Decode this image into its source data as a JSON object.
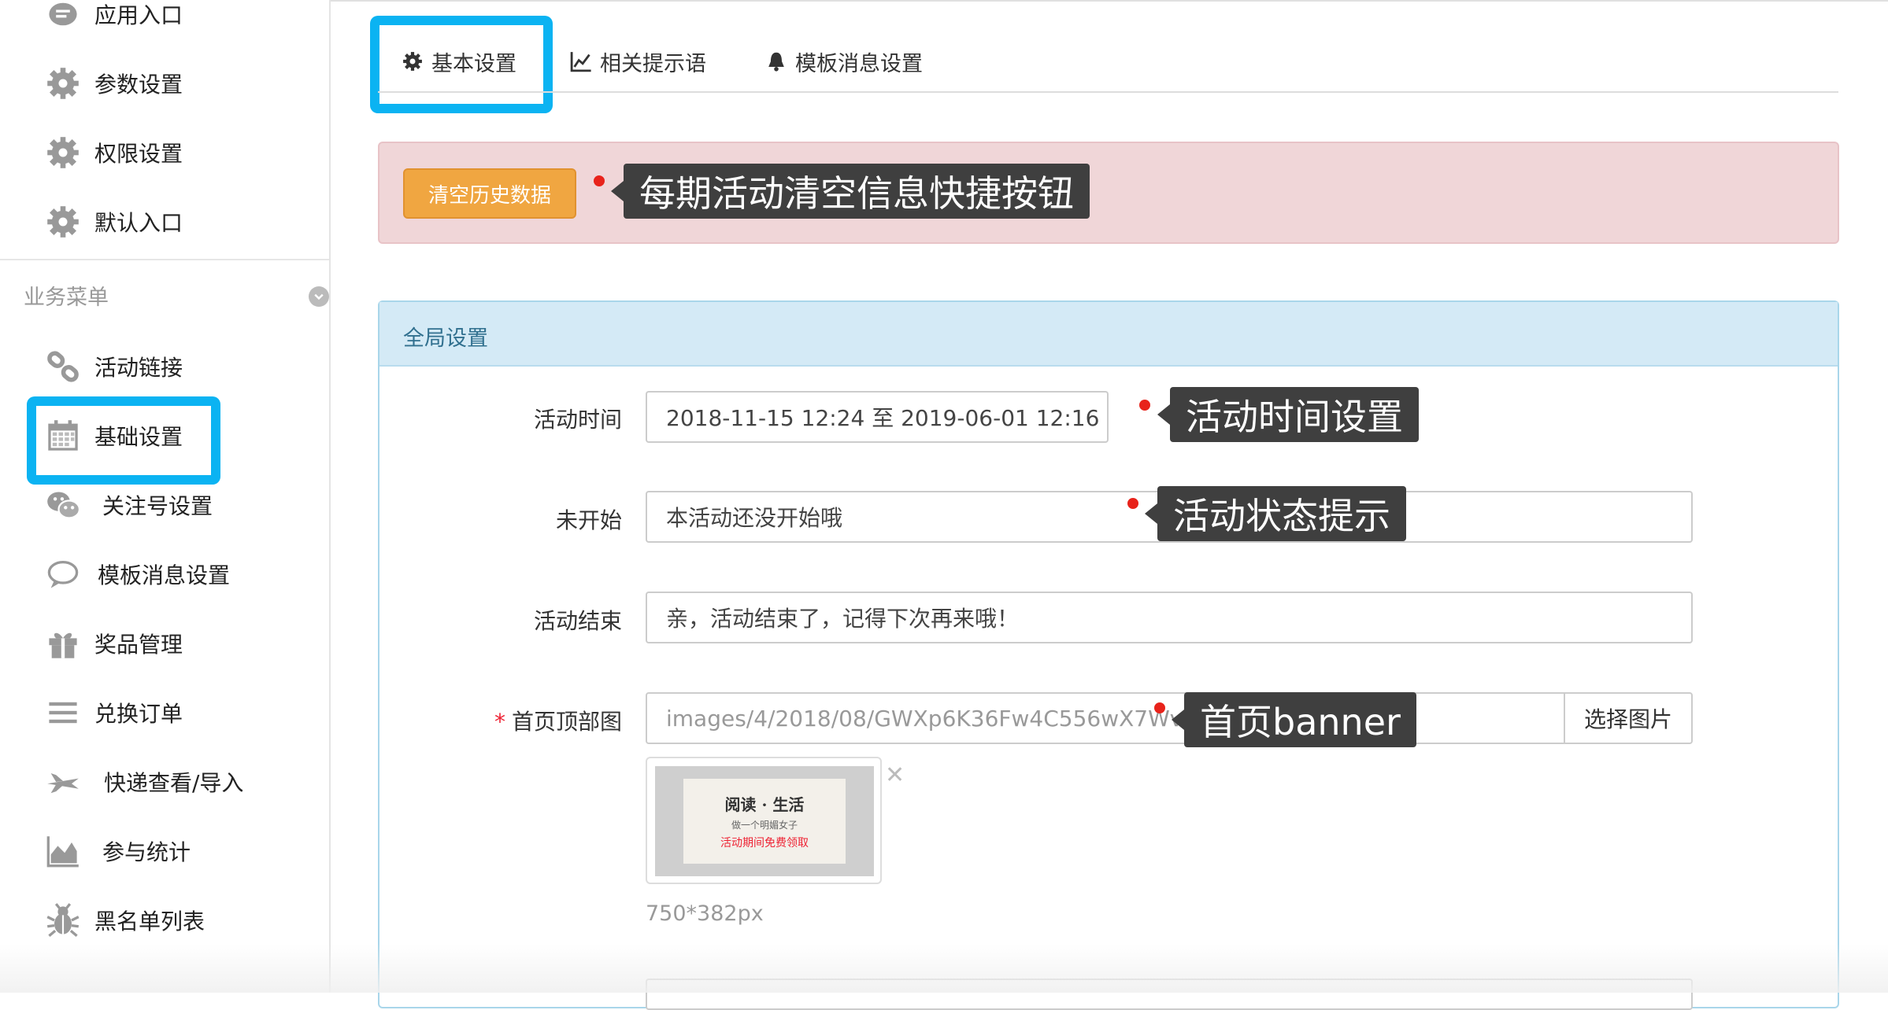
{
  "sidebar": {
    "top_items": [
      {
        "label": "应用入口",
        "icon": "chat-icon"
      },
      {
        "label": "参数设置",
        "icon": "gear-icon"
      },
      {
        "label": "权限设置",
        "icon": "gear-icon"
      },
      {
        "label": "默认入口",
        "icon": "gear-icon"
      }
    ],
    "section_label": "业务菜单",
    "items": [
      {
        "label": "活动链接",
        "icon": "link-icon"
      },
      {
        "label": "基础设置",
        "icon": "calendar-icon",
        "highlighted": true
      },
      {
        "label": "关注号设置",
        "icon": "wechat-icon"
      },
      {
        "label": "模板消息设置",
        "icon": "message-icon"
      },
      {
        "label": "奖品管理",
        "icon": "gift-icon"
      },
      {
        "label": "兑换订单",
        "icon": "list-icon"
      },
      {
        "label": "快递查看/导入",
        "icon": "plane-icon"
      },
      {
        "label": "参与统计",
        "icon": "area-chart-icon"
      },
      {
        "label": "黑名单列表",
        "icon": "bug-icon"
      }
    ]
  },
  "tabs": [
    {
      "label": "基本设置",
      "icon": "gear-icon",
      "active": true
    },
    {
      "label": "相关提示语",
      "icon": "line-chart-icon"
    },
    {
      "label": "模板消息设置",
      "icon": "bell-icon"
    }
  ],
  "alert": {
    "button_label": "清空历史数据",
    "tooltip": "每期活动清空信息快捷按钮"
  },
  "panel": {
    "title": "全局设置",
    "fields": {
      "activity_time": {
        "label": "活动时间",
        "value": "2018-11-15 12:24 至 2019-06-01 12:16",
        "tooltip": "活动时间设置"
      },
      "not_started": {
        "label": "未开始",
        "value": "本活动还没开始哦",
        "tooltip": "活动状态提示"
      },
      "ended": {
        "label": "活动结束",
        "value": "亲，活动结束了，记得下次再来哦！"
      },
      "banner": {
        "label": "首页顶部图",
        "value": "images/4/2018/08/GWXp6K36Fw4C556wX7WvxvX",
        "button": "选择图片",
        "tooltip": "首页banner",
        "size_hint": "750*382px"
      }
    },
    "thumbnail": {
      "line1": "阅读 · 生活",
      "line2": "做一个明媚女子",
      "line3": "活动期间免费领取"
    }
  },
  "colors": {
    "highlight": "#0bb3f2",
    "orange_button": "#f0a641",
    "alert_bg": "#f0d6d8",
    "panel_head": "#d4eaf6"
  }
}
